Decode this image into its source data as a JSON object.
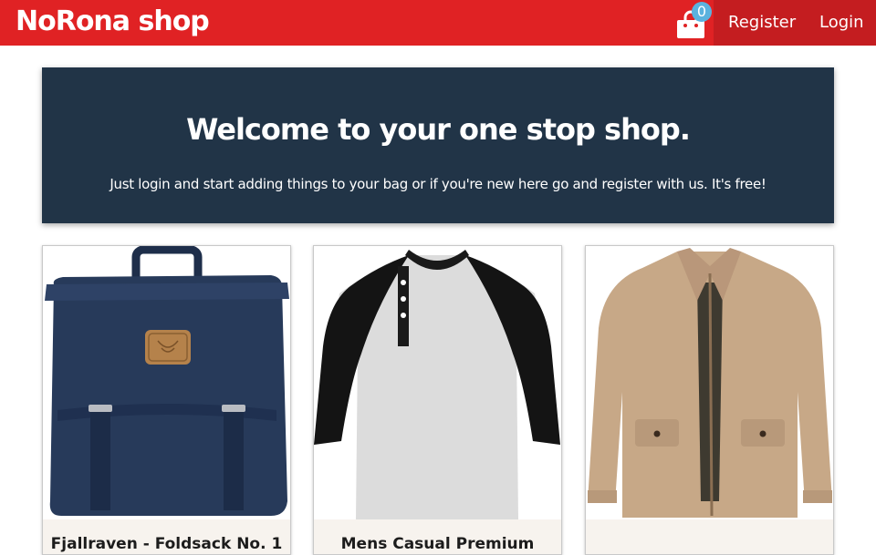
{
  "navbar": {
    "brand": "NoRona shop",
    "cart_count": "0",
    "register_label": "Register",
    "login_label": "Login"
  },
  "hero": {
    "heading": "Welcome to your one stop shop.",
    "subtext": "Just login and start adding things to your bag or if you're new here go and register with us. It's free!"
  },
  "products": [
    {
      "title": "Fjallraven - Foldsack No. 1",
      "image": "navy backpack"
    },
    {
      "title": "Mens Casual Premium",
      "image": "raglan henley t-shirt"
    },
    {
      "title": "",
      "image": "khaki jacket"
    }
  ],
  "colors": {
    "navbar": "#e02224",
    "navbar_dark": "#c41d20",
    "hero": "#213447",
    "badge": "#5bb2de"
  }
}
